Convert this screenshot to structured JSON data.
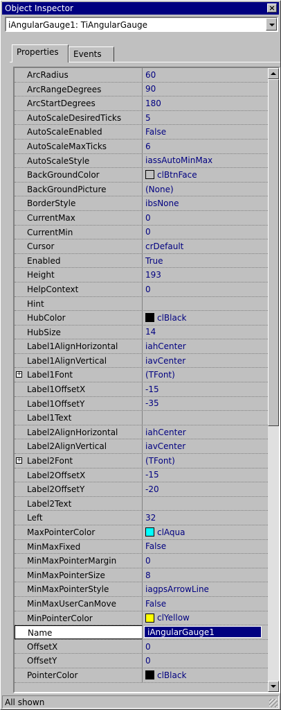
{
  "window": {
    "title": "Object Inspector",
    "close_glyph": "×"
  },
  "component_selector": {
    "value": "iAngularGauge1: TiAngularGauge"
  },
  "tabs": [
    {
      "label": "Properties",
      "active": true
    },
    {
      "label": "Events",
      "active": false
    }
  ],
  "properties": [
    {
      "name": "ArcRadius",
      "value": "60"
    },
    {
      "name": "ArcRangeDegrees",
      "value": "90"
    },
    {
      "name": "ArcStartDegrees",
      "value": "180"
    },
    {
      "name": "AutoScaleDesiredTicks",
      "value": "5"
    },
    {
      "name": "AutoScaleEnabled",
      "value": "False"
    },
    {
      "name": "AutoScaleMaxTicks",
      "value": "6"
    },
    {
      "name": "AutoScaleStyle",
      "value": "iassAutoMinMax"
    },
    {
      "name": "BackGroundColor",
      "value": "clBtnFace",
      "swatch": "#c0c0c0"
    },
    {
      "name": "BackGroundPicture",
      "value": "(None)"
    },
    {
      "name": "BorderStyle",
      "value": "ibsNone"
    },
    {
      "name": "CurrentMax",
      "value": "0"
    },
    {
      "name": "CurrentMin",
      "value": "0"
    },
    {
      "name": "Cursor",
      "value": "crDefault"
    },
    {
      "name": "Enabled",
      "value": "True"
    },
    {
      "name": "Height",
      "value": "193"
    },
    {
      "name": "HelpContext",
      "value": "0"
    },
    {
      "name": "Hint",
      "value": ""
    },
    {
      "name": "HubColor",
      "value": "clBlack",
      "swatch": "#000000"
    },
    {
      "name": "HubSize",
      "value": "14"
    },
    {
      "name": "Label1AlignHorizontal",
      "value": "iahCenter"
    },
    {
      "name": "Label1AlignVertical",
      "value": "iavCenter"
    },
    {
      "name": "Label1Font",
      "value": "(TFont)",
      "expandable": true
    },
    {
      "name": "Label1OffsetX",
      "value": "-15"
    },
    {
      "name": "Label1OffsetY",
      "value": "-35"
    },
    {
      "name": "Label1Text",
      "value": ""
    },
    {
      "name": "Label2AlignHorizontal",
      "value": "iahCenter"
    },
    {
      "name": "Label2AlignVertical",
      "value": "iavCenter"
    },
    {
      "name": "Label2Font",
      "value": "(TFont)",
      "expandable": true
    },
    {
      "name": "Label2OffsetX",
      "value": "-15"
    },
    {
      "name": "Label2OffsetY",
      "value": "-20"
    },
    {
      "name": "Label2Text",
      "value": ""
    },
    {
      "name": "Left",
      "value": "32"
    },
    {
      "name": "MaxPointerColor",
      "value": "clAqua",
      "swatch": "#00ffff"
    },
    {
      "name": "MinMaxFixed",
      "value": "False"
    },
    {
      "name": "MinMaxPointerMargin",
      "value": "0"
    },
    {
      "name": "MinMaxPointerSize",
      "value": "8"
    },
    {
      "name": "MinMaxPointerStyle",
      "value": "iagpsArrowLine"
    },
    {
      "name": "MinMaxUserCanMove",
      "value": "False"
    },
    {
      "name": "MinPointerColor",
      "value": "clYellow",
      "swatch": "#ffff00"
    },
    {
      "name": "Name",
      "value": "iAngularGauge1",
      "selected": true
    },
    {
      "name": "OffsetX",
      "value": "0"
    },
    {
      "name": "OffsetY",
      "value": "0"
    },
    {
      "name": "PointerColor",
      "value": "clBlack",
      "swatch": "#000000"
    }
  ],
  "expander_glyph": "+",
  "status": {
    "text": "All shown"
  }
}
